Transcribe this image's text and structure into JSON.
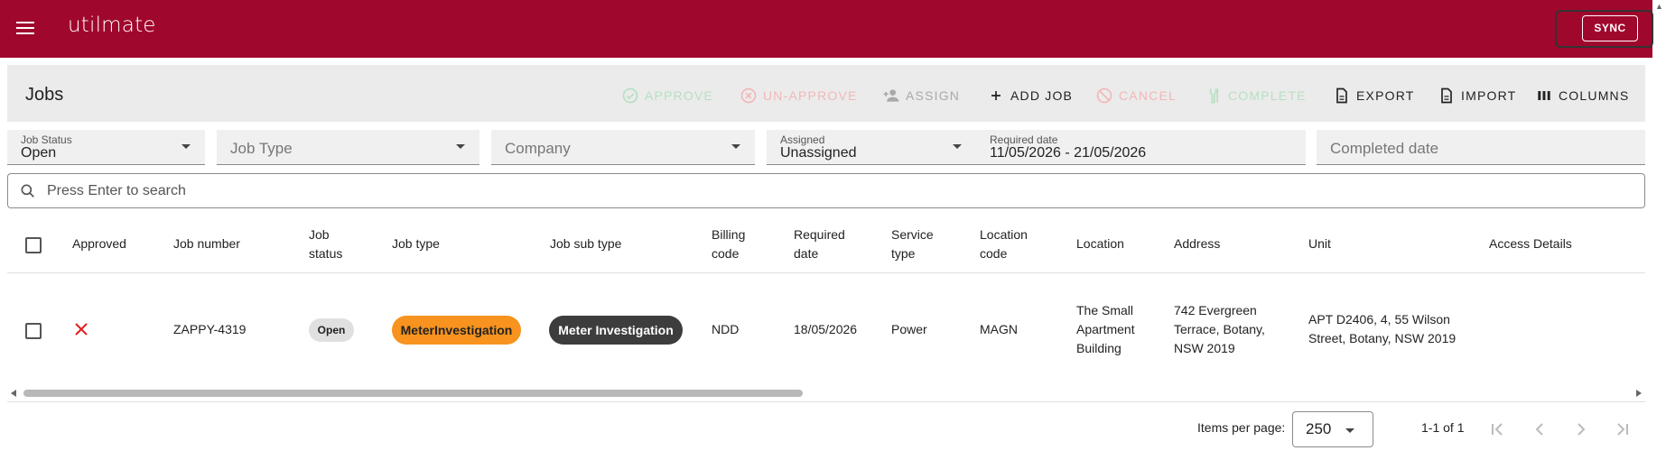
{
  "app": {
    "brand": "utilmate",
    "sync_label": "SYNC"
  },
  "toolbar": {
    "title": "Jobs",
    "actions": [
      {
        "label": "APPROVE",
        "icon": "check-circle-icon",
        "state": "disabled"
      },
      {
        "label": "UN-APPROVE",
        "icon": "x-circle-icon",
        "state": "disabled"
      },
      {
        "label": "ASSIGN",
        "icon": "person-add-icon",
        "state": "disabled"
      },
      {
        "label": "ADD JOB",
        "icon": "plus-icon",
        "state": "enabled"
      },
      {
        "label": "CANCEL",
        "icon": "block-icon",
        "state": "disabled"
      },
      {
        "label": "COMPLETE",
        "icon": "wrench-icon",
        "state": "disabled"
      },
      {
        "label": "EXPORT",
        "icon": "document-icon",
        "state": "enabled"
      },
      {
        "label": "IMPORT",
        "icon": "document-icon",
        "state": "enabled"
      },
      {
        "label": "COLUMNS",
        "icon": "columns-icon",
        "state": "enabled"
      }
    ]
  },
  "filters": {
    "job_status": {
      "label": "Job Status",
      "value": "Open"
    },
    "job_type": {
      "placeholder": "Job Type"
    },
    "company": {
      "placeholder": "Company"
    },
    "assigned": {
      "label": "Assigned",
      "value": "Unassigned"
    },
    "required_date": {
      "label": "Required date",
      "value": "11/05/2026 - 21/05/2026"
    },
    "completed_date": {
      "placeholder": "Completed date"
    }
  },
  "search": {
    "placeholder": "Press Enter to search"
  },
  "table": {
    "headers": {
      "approved": "Approved",
      "job_number": "Job number",
      "job_status_1": "Job",
      "job_status_2": "status",
      "job_type": "Job type",
      "job_sub_type": "Job sub type",
      "billing_code_1": "Billing",
      "billing_code_2": "code",
      "required_date_1": "Required",
      "required_date_2": "date",
      "service_type_1": "Service",
      "service_type_2": "type",
      "location_code_1": "Location",
      "location_code_2": "code",
      "location": "Location",
      "address": "Address",
      "unit": "Unit",
      "access_details": "Access Details"
    },
    "rows": [
      {
        "approved_icon": "x-icon",
        "job_number": "ZAPPY-4319",
        "job_status": "Open",
        "job_type": "MeterInvestigation",
        "job_sub_type": "Meter Investigation",
        "billing_code": "NDD",
        "required_date": "18/05/2026",
        "service_type": "Power",
        "location_code": "MAGN",
        "location_1": "The Small",
        "location_2": "Apartment",
        "location_3": "Building",
        "address_1": "742 Evergreen",
        "address_2": "Terrace, Botany,",
        "address_3": "NSW 2019",
        "unit_1": "APT D2406, 4, 55 Wilson",
        "unit_2": "Street, Botany, NSW 2019",
        "access_details": ""
      }
    ]
  },
  "pagination": {
    "items_per_page_label": "Items per page:",
    "items_per_page": "250",
    "range": "1-1 of 1"
  },
  "colors": {
    "brand": "#a0072d",
    "job_type_chip": "#f7931e",
    "sub_type_chip": "#3d3d3d",
    "approve_disabled": "#b7dfc1",
    "cancel_disabled": "#f2b7b7"
  }
}
